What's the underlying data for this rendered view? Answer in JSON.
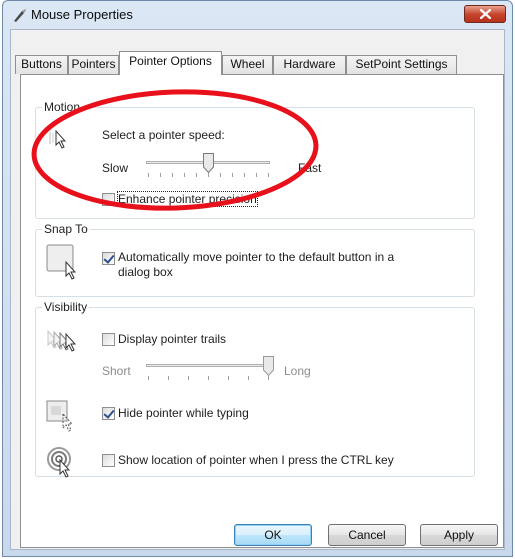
{
  "window": {
    "title": "Mouse Properties"
  },
  "tabs": [
    {
      "label": "Buttons"
    },
    {
      "label": "Pointers"
    },
    {
      "label": "Pointer Options",
      "active": true
    },
    {
      "label": "Wheel"
    },
    {
      "label": "Hardware"
    },
    {
      "label": "SetPoint Settings"
    }
  ],
  "motion": {
    "label": "Motion",
    "speed_prompt": "Select a pointer speed:",
    "slow_label": "Slow",
    "fast_label": "Fast",
    "speed_level": 0.5,
    "enhance_precision": {
      "label": "Enhance pointer precision",
      "checked": false
    }
  },
  "snap_to": {
    "label": "Snap To",
    "auto_move": {
      "label_line1": "Automatically move pointer to the default button in a",
      "label_line2": "dialog box",
      "checked": true
    }
  },
  "visibility": {
    "label": "Visibility",
    "trails": {
      "label": "Display pointer trails",
      "checked": false
    },
    "short_label": "Short",
    "long_label": "Long",
    "trail_level": 1.0,
    "hide_typing": {
      "label": "Hide pointer while typing",
      "checked": true
    },
    "show_ctrl": {
      "label": "Show location of pointer when I press the CTRL key",
      "checked": false
    }
  },
  "buttons": {
    "ok": "OK",
    "cancel": "Cancel",
    "apply": "Apply"
  },
  "annotation": {
    "color": "#e8101a"
  },
  "icons": [
    "mouse-properties-icon",
    "close-icon",
    "pointer-speed-icon",
    "snap-to-icon",
    "pointer-trails-icon",
    "hide-pointer-icon",
    "ctrl-locate-icon"
  ]
}
